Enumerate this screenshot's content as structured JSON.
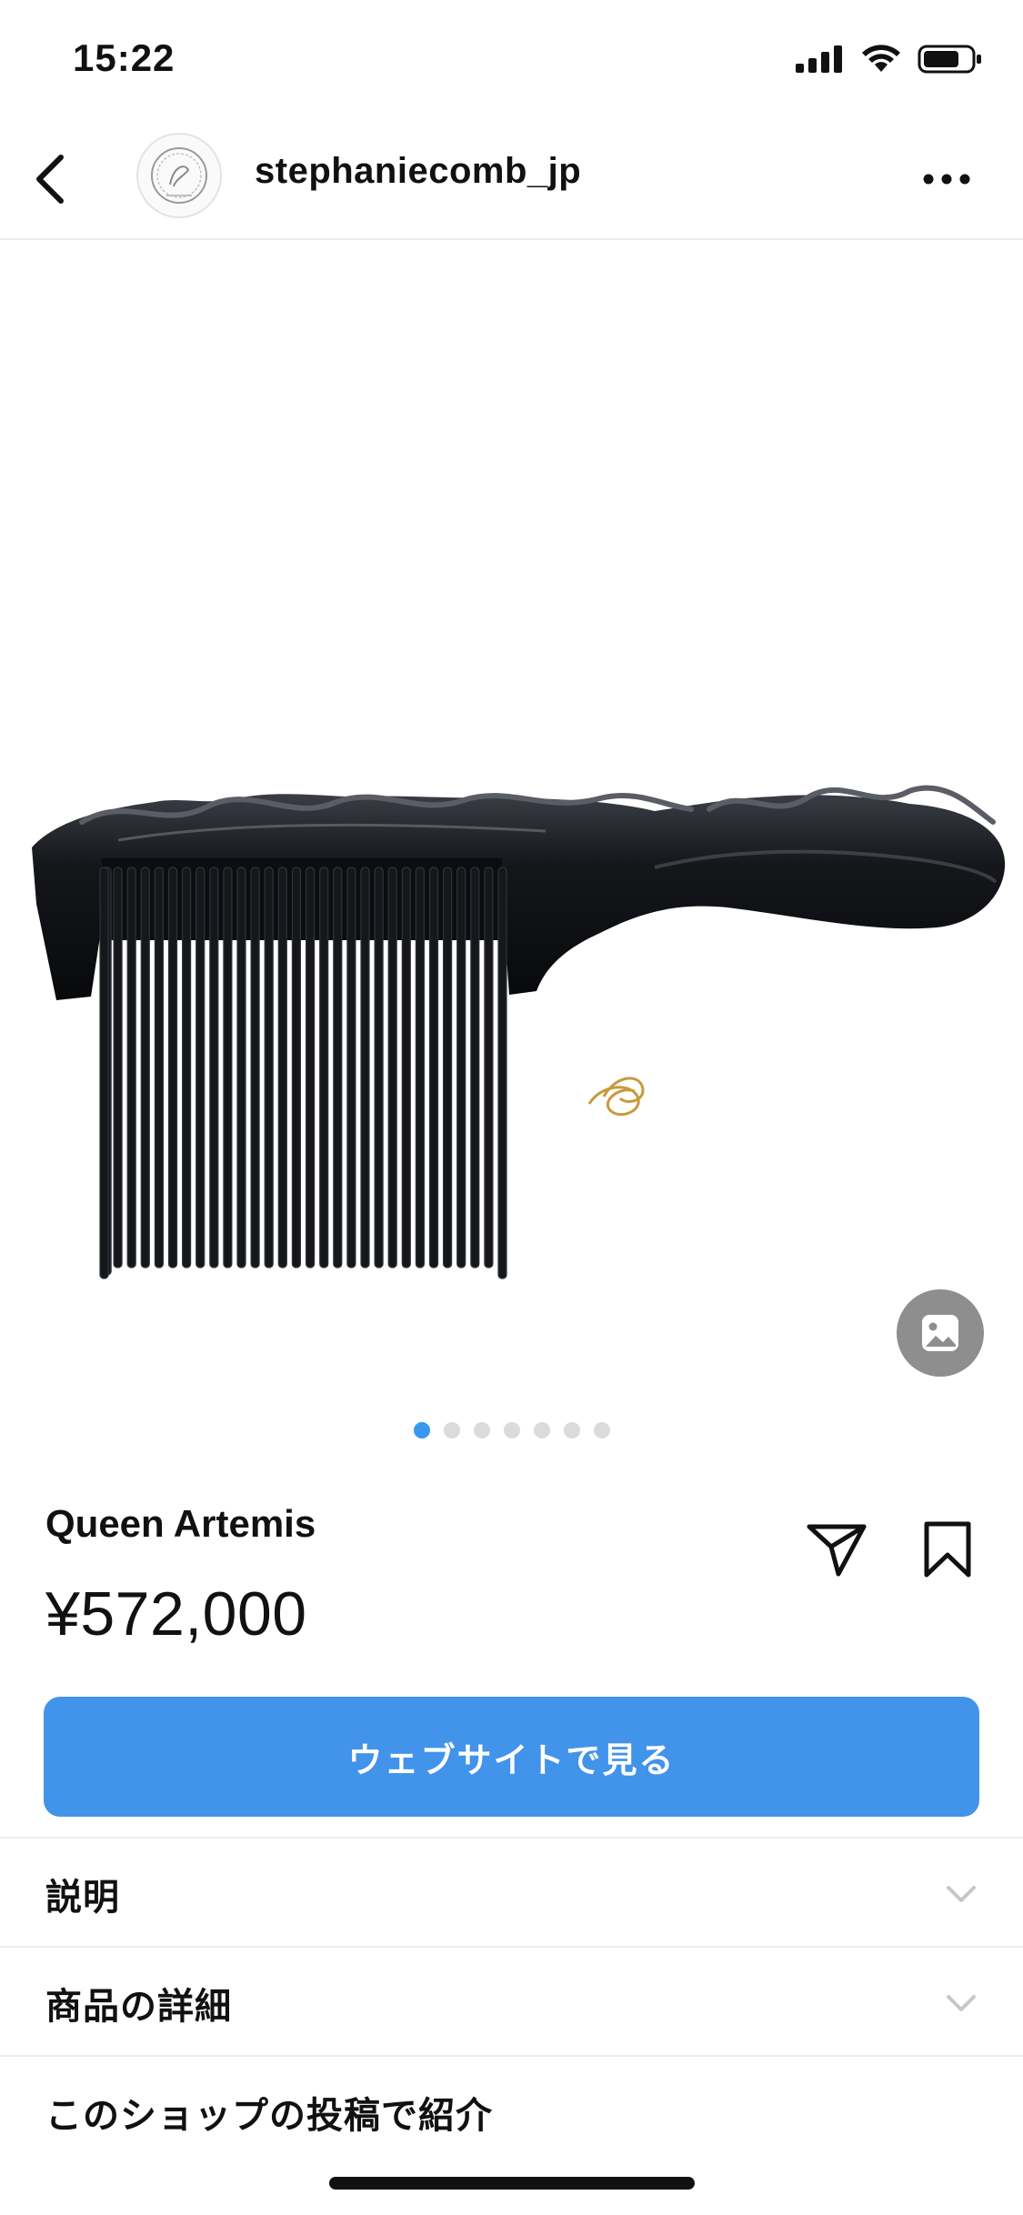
{
  "status_bar": {
    "time": "15:22"
  },
  "header": {
    "username": "stephaniecomb_jp",
    "avatar_icon": "brand-logo-icon",
    "back_icon": "chevron-left-icon",
    "more_icon": "more-horizontal-icon"
  },
  "gallery": {
    "total_pages": 7,
    "current_page": 1,
    "badge_icon": "image-gallery-icon"
  },
  "product": {
    "name": "Queen Artemis",
    "price": "¥572,000"
  },
  "actions": {
    "share_icon": "send-icon",
    "save_icon": "bookmark-icon",
    "website_button_label": "ウェブサイトで見る"
  },
  "sections": [
    {
      "label": "説明"
    },
    {
      "label": "商品の詳細"
    },
    {
      "label": "このショップの投稿で紹介"
    }
  ],
  "colors": {
    "accent": "#4293ea",
    "active_dot": "#3897f0",
    "inactive_dot": "#dbdbdb"
  }
}
